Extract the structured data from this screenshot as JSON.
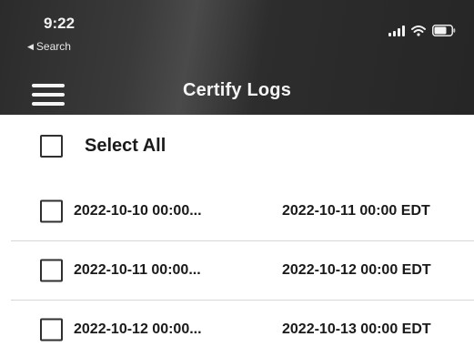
{
  "status_bar": {
    "time": "9:22",
    "back_label": "Search",
    "back_arrow": "◀"
  },
  "nav": {
    "title": "Certify Logs",
    "menu_icon": "hamburger-menu-icon"
  },
  "select_all": {
    "label": "Select All",
    "checked": false
  },
  "logs": [
    {
      "start": "2022-10-10 00:00...",
      "end": "2022-10-11 00:00 EDT",
      "checked": false
    },
    {
      "start": "2022-10-11 00:00...",
      "end": "2022-10-12 00:00 EDT",
      "checked": false
    },
    {
      "start": "2022-10-12 00:00...",
      "end": "2022-10-13 00:00 EDT",
      "checked": false
    }
  ],
  "colors": {
    "header_bg": "#2b2b2b",
    "text": "#1a1a1a",
    "divider": "#d6d6d6"
  }
}
